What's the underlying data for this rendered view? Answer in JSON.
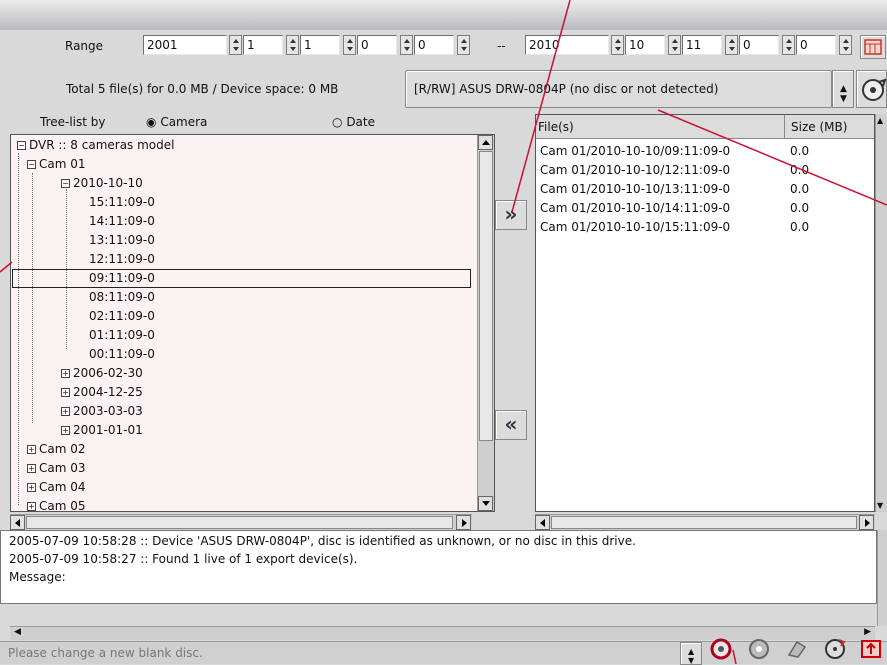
{
  "range": {
    "label": "Range",
    "from": {
      "year": "2001",
      "month": "1",
      "day": "1",
      "hour": "0",
      "minute": "0"
    },
    "separator": "--",
    "to": {
      "year": "2010",
      "month": "10",
      "day": "11",
      "hour": "0",
      "minute": "0"
    }
  },
  "summary": "Total 5 file(s) for 0.0 MB / Device space: 0 MB",
  "device": {
    "selected": "[R/RW] ASUS DRW-0804P (no disc or not detected)"
  },
  "treelist": {
    "label": "Tree-list by",
    "options": [
      {
        "label": "Camera",
        "selected": true
      },
      {
        "label": "Date",
        "selected": false
      }
    ]
  },
  "tree": {
    "root": "DVR :: 8 cameras model",
    "cam01": "Cam 01",
    "date_open": "2010-10-10",
    "times": [
      "15:11:09-0",
      "14:11:09-0",
      "13:11:09-0",
      "12:11:09-0",
      "09:11:09-0",
      "08:11:09-0",
      "02:11:09-0",
      "01:11:09-0",
      "00:11:09-0"
    ],
    "selected_time": "09:11:09-0",
    "other_dates": [
      "2006-02-30",
      "2004-12-25",
      "2003-03-03",
      "2001-01-01"
    ],
    "other_cams": [
      "Cam 02",
      "Cam 03",
      "Cam 04",
      "Cam 05"
    ]
  },
  "buttons": {
    "add": "»",
    "remove": "«"
  },
  "files": {
    "col_file": "File(s)",
    "col_size": "Size (MB)",
    "rows": [
      {
        "file": "Cam 01/2010-10-10/09:11:09-0",
        "size": "0.0"
      },
      {
        "file": "Cam 01/2010-10-10/12:11:09-0",
        "size": "0.0"
      },
      {
        "file": "Cam 01/2010-10-10/13:11:09-0",
        "size": "0.0"
      },
      {
        "file": "Cam 01/2010-10-10/14:11:09-0",
        "size": "0.0"
      },
      {
        "file": "Cam 01/2010-10-10/15:11:09-0",
        "size": "0.0"
      }
    ]
  },
  "log": {
    "lines": [
      "2005-07-09 10:58:28 :: Device 'ASUS DRW-0804P', disc is identified as unknown, or no disc in this drive.",
      "2005-07-09 10:58:27 :: Found 1 live of 1 export device(s).",
      "Message:"
    ]
  },
  "status": {
    "text": "Please change a new blank disc."
  },
  "colors": {
    "annotation": "#cc1030",
    "select_border": "#222222"
  }
}
